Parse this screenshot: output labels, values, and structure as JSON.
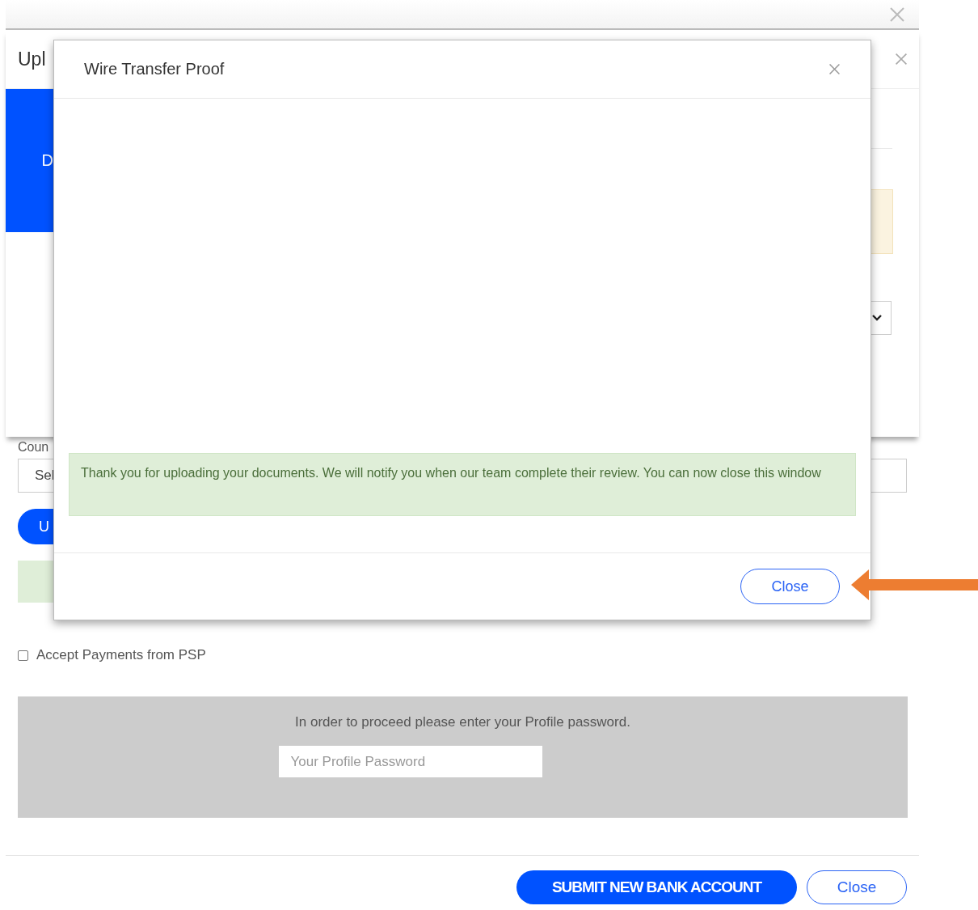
{
  "background_dialog": {
    "title": "Upl",
    "side_tab": "D"
  },
  "form": {
    "country_label": "Coun",
    "country_select": "Sel",
    "upload_button": "U",
    "accept_psp": {
      "label": "Accept Payments from PSP",
      "checked": false
    },
    "password_panel": {
      "prompt": "In order to proceed please enter your Profile password.",
      "placeholder": "Your Profile Password"
    },
    "buttons": [
      {
        "label": "SUBMIT NEW BANK ACCOUNT",
        "kind": "primary"
      },
      {
        "label": "Close",
        "kind": "outline"
      }
    ]
  },
  "modal": {
    "title": "Wire Transfer Proof",
    "message": "Thank you for uploading your documents. We will notify you when our team complete their review. You can now close this window",
    "button": "Close"
  }
}
